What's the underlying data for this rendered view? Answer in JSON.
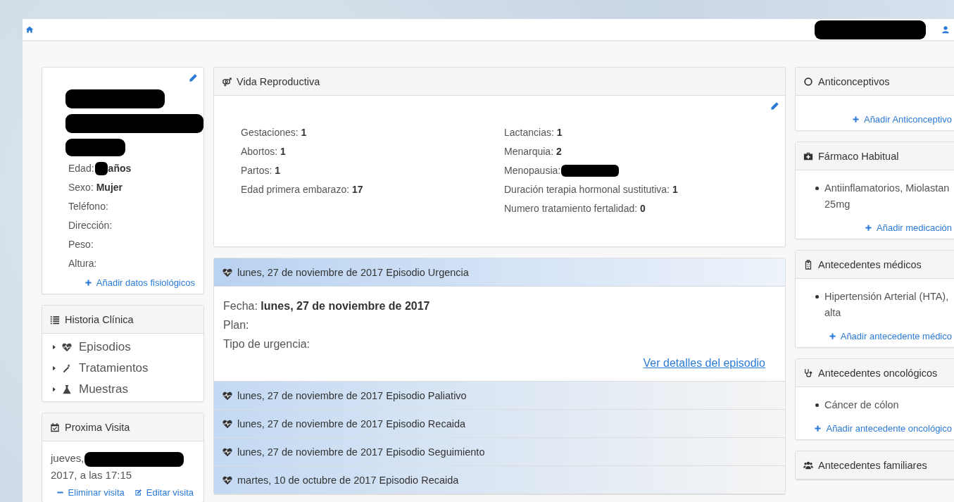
{
  "navbar": {
    "user": {
      "redacted": true
    }
  },
  "patient": {
    "name": {
      "redacted": true
    },
    "fields": [
      {
        "text": "Edad:",
        "redacted": true,
        "after": "años"
      },
      {
        "text": "Sexo: **Mujer**"
      },
      {
        "text": "Teléfono:"
      },
      {
        "text": "Dirección:"
      },
      {
        "text": "Peso:"
      },
      {
        "text": "Altura:"
      }
    ],
    "add_link": "Añadir datos fisiológicos"
  },
  "history": {
    "title": "Historia Clínica",
    "items": [
      {
        "label": "Episodios",
        "kind": "episodes",
        "expanded": false
      },
      {
        "label": "Tratamientos",
        "kind": "treatments",
        "expanded": false
      },
      {
        "label": "Muestras",
        "kind": "samples",
        "expanded": false
      }
    ]
  },
  "next_visit": {
    "title": "Proxima Visita",
    "date": {
      "text": "jueves,",
      "redacted": true,
      "after": "2017, a las 17:15"
    },
    "actions": [
      {
        "kind": "remove",
        "label": "Eliminar visita"
      },
      {
        "kind": "edit",
        "label": "Editar visita"
      }
    ]
  },
  "reproductive": {
    "title": "Vida Reproductiva",
    "columns": [
      [
        {
          "text": "Gestaciones: **1**"
        },
        {
          "text": "Abortos: **1**"
        },
        {
          "text": "Partos: **1**"
        },
        {
          "text": "Edad primera embarazo: **17**"
        }
      ],
      [
        {
          "text": "Lactancias: **1**"
        },
        {
          "text": "Menarquia: **2**"
        },
        {
          "text": "Menopausia:",
          "redacted": true
        },
        {
          "text": "Duración terapia hormonal sustitutiva: **1**"
        },
        {
          "text": "Numero tratamiento fertalidad: **0**"
        }
      ]
    ]
  },
  "episodes": [
    {
      "title": "lunes, 27 de noviembre de 2017 Episodio Urgencia",
      "expanded": true,
      "details": [
        {
          "text": "Fecha: **lunes, 27 de noviembre de 2017**"
        },
        {
          "text": "Plan:"
        },
        {
          "text": "Tipo de urgencia:"
        }
      ],
      "link": "Ver detalles del episodio"
    },
    {
      "title": "lunes, 27 de noviembre de 2017 Episodio Paliativo",
      "expanded": false
    },
    {
      "title": "lunes, 27 de noviembre de 2017 Episodio Recaida",
      "expanded": false
    },
    {
      "title": "lunes, 27 de noviembre de 2017 Episodio Seguimiento",
      "expanded": false
    },
    {
      "title": "martes, 10 de octubre de 2017 Episodio Recaida",
      "expanded": false
    }
  ],
  "side_panels": [
    {
      "title": "Anticonceptivos",
      "kind": "contraceptives",
      "add_link": "Añadir Anticonceptivo"
    },
    {
      "title": "Fármaco Habitual",
      "kind": "medication",
      "items": [
        "Antiinflamatorios, Miolastan 25mg"
      ],
      "add_link": "Añadir medicación"
    },
    {
      "title": "Antecedentes médicos",
      "kind": "medical",
      "items": [
        "Hipertensión Arterial (HTA), alta"
      ],
      "add_link": "Añadir antecedente médico"
    },
    {
      "title": "Antecedentes oncológicos",
      "kind": "oncology",
      "items": [
        "Cáncer de cólon"
      ],
      "add_link": "Añadir antecedente oncológico"
    },
    {
      "title": "Antecedentes familiares",
      "kind": "family"
    }
  ]
}
